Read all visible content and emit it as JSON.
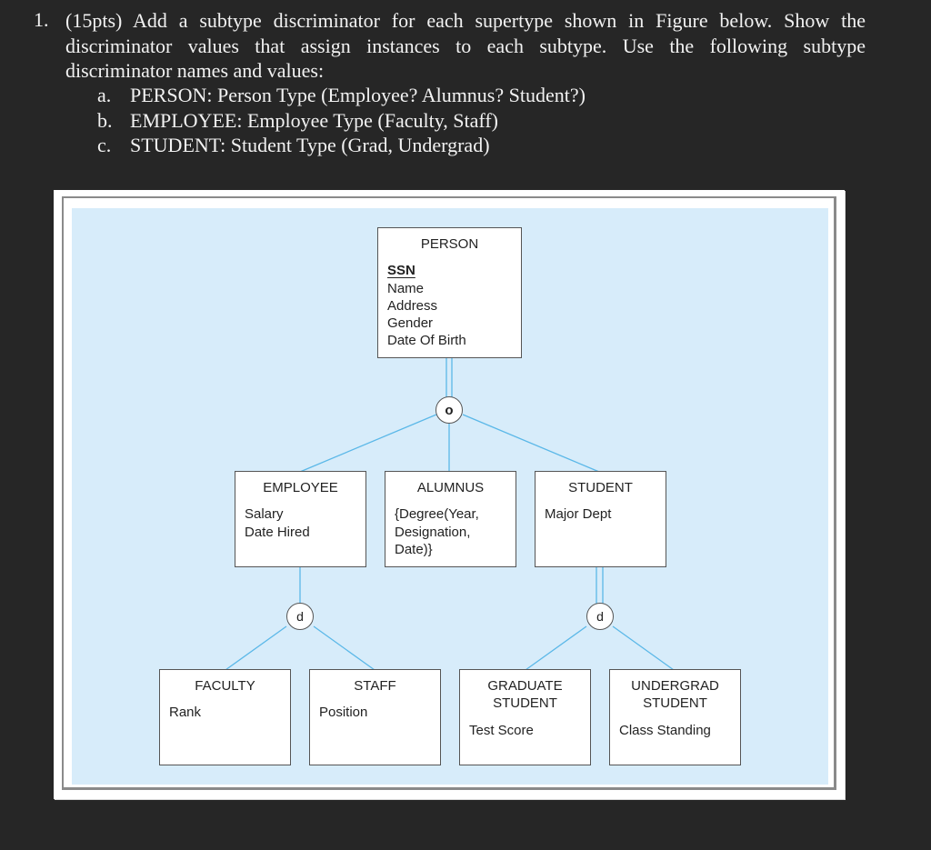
{
  "question": {
    "number": "1.",
    "lines": [
      "(15pts) Add a subtype discriminator for each supertype shown in Figure below. Show the",
      "discriminator values that assign instances to each subtype. Use the following subtype",
      "discriminator names and values:"
    ],
    "items": [
      {
        "label": "a.",
        "text": "PERSON: Person Type (Employee? Alumnus? Student?)"
      },
      {
        "label": "b.",
        "text": "EMPLOYEE: Employee Type (Faculty, Staff)"
      },
      {
        "label": "c.",
        "text": "STUDENT: Student Type (Grad, Undergrad)"
      }
    ]
  },
  "diagram": {
    "colors": {
      "background": "#d7ecfa",
      "line": "#5bb8e8",
      "box_border": "#555555"
    },
    "entities": {
      "person": {
        "name": "PERSON",
        "key": "SSN",
        "attributes": [
          "Name",
          "Address",
          "Gender",
          "Date Of Birth"
        ]
      },
      "employee": {
        "name": "EMPLOYEE",
        "attributes": [
          "Salary",
          "Date Hired"
        ]
      },
      "alumnus": {
        "name": "ALUMNUS",
        "attributes": [
          "{Degree(Year,",
          "Designation,",
          "Date)}"
        ]
      },
      "student": {
        "name": "STUDENT",
        "attributes": [
          "Major Dept"
        ]
      },
      "faculty": {
        "name": "FACULTY",
        "attributes": [
          "Rank"
        ]
      },
      "staff": {
        "name": "STAFF",
        "attributes": [
          "Position"
        ]
      },
      "graduate_student": {
        "name_lines": [
          "GRADUATE",
          "STUDENT"
        ],
        "attributes": [
          "Test Score"
        ]
      },
      "undergrad_student": {
        "name_lines": [
          "UNDERGRAD",
          "STUDENT"
        ],
        "attributes": [
          "Class Standing"
        ]
      }
    },
    "constraints": {
      "person_overlap": "o",
      "employee_disjoint": "d",
      "student_disjoint": "d"
    }
  }
}
